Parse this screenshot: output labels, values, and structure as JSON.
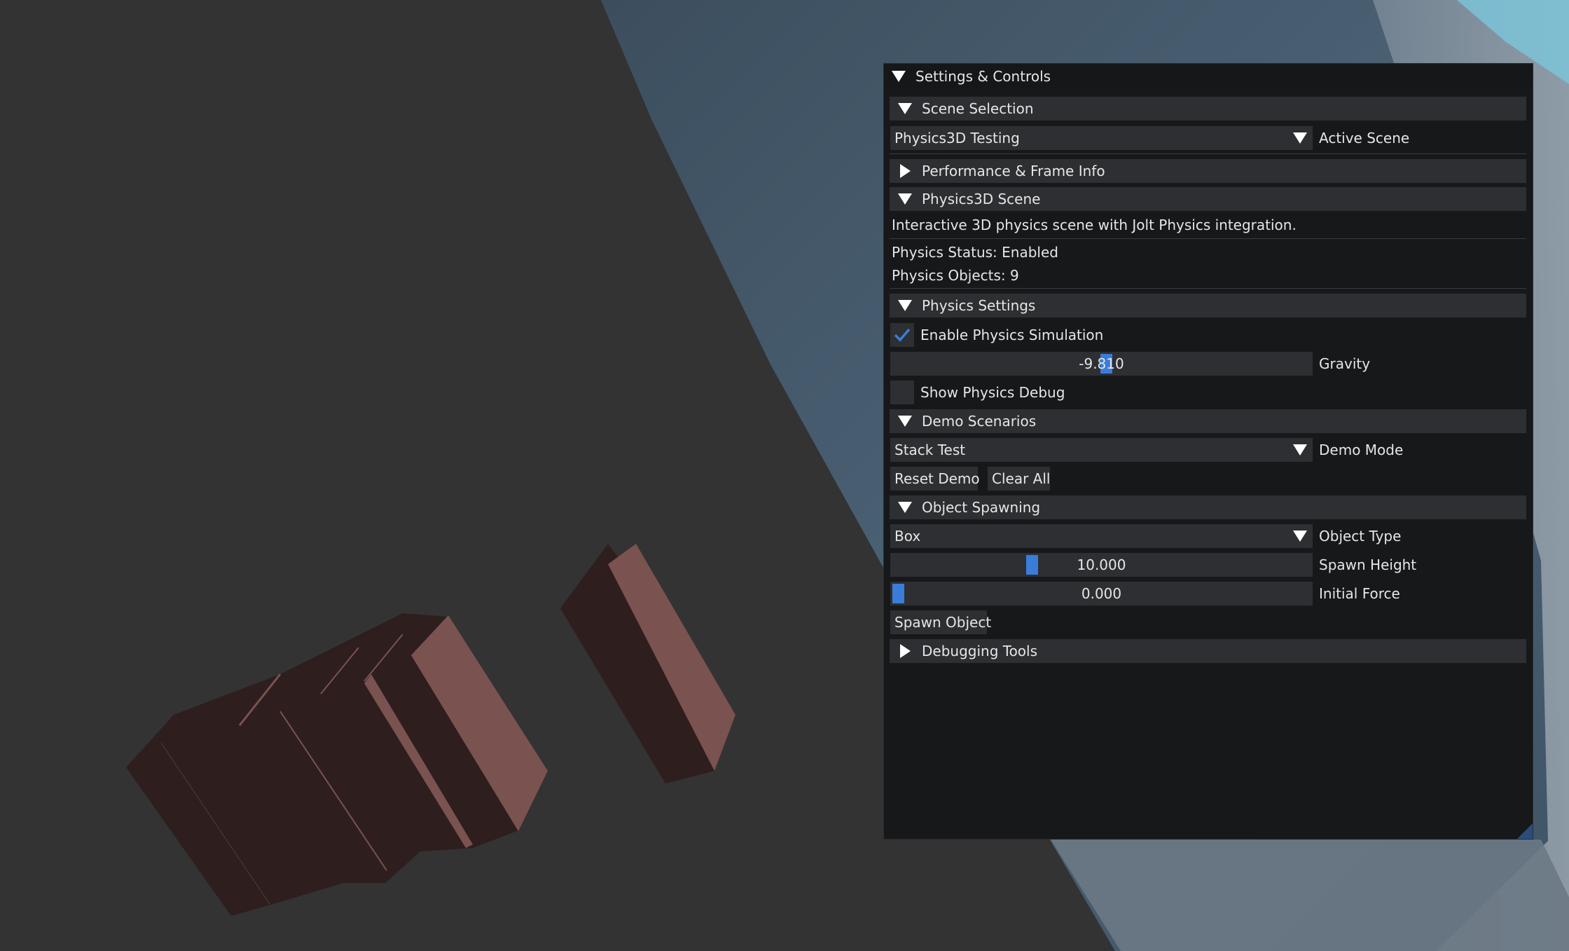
{
  "window": {
    "title": "Settings & Controls"
  },
  "scene_selection": {
    "header": "Scene Selection",
    "combo_value": "Physics3D Testing",
    "combo_label": "Active Scene"
  },
  "performance": {
    "header": "Performance & Frame Info"
  },
  "physics3d_scene": {
    "header": "Physics3D Scene",
    "description": "Interactive 3D physics scene with Jolt Physics integration.",
    "status": "Physics Status: Enabled",
    "objects": "Physics Objects: 9"
  },
  "physics_settings": {
    "header": "Physics Settings",
    "enable_label": "Enable Physics Simulation",
    "enable_checked": true,
    "gravity_value": "-9.810",
    "gravity_label": "Gravity",
    "debug_label": "Show Physics Debug",
    "debug_checked": false
  },
  "demo_scenarios": {
    "header": "Demo Scenarios",
    "mode_value": "Stack Test",
    "mode_label": "Demo Mode",
    "reset_button": "Reset Demo",
    "clear_button": "Clear All"
  },
  "object_spawning": {
    "header": "Object Spawning",
    "type_value": "Box",
    "type_label": "Object Type",
    "height_value": "10.000",
    "height_label": "Spawn Height",
    "height_fraction": 0.33,
    "force_value": "0.000",
    "force_label": "Initial Force",
    "force_fraction": 0.0,
    "spawn_button": "Spawn Object"
  },
  "debugging": {
    "header": "Debugging Tools"
  },
  "colors": {
    "accent": "#3a7dd8",
    "frame_bg": "#2d2f32",
    "window_bg": "#17181a",
    "box_light": "#7a5250",
    "box_dark": "#2e1e1e"
  }
}
